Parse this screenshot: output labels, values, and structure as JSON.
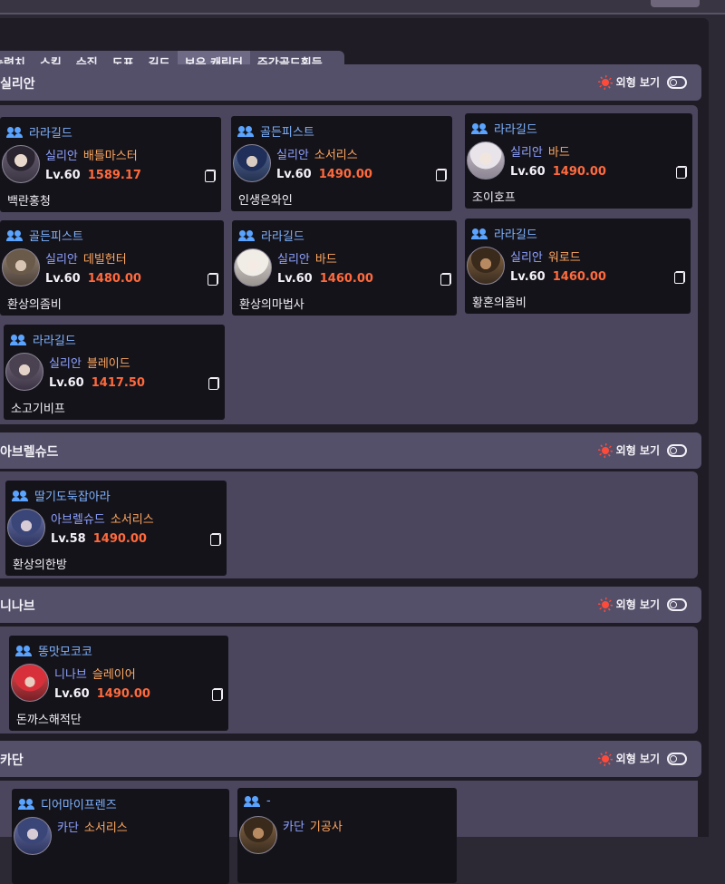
{
  "tabs": [
    "능력치",
    "스킬",
    "수집",
    "도표",
    "길드",
    "보유 캐릭터",
    "주간골드획득"
  ],
  "appearance_label": "외형 보기",
  "colors": {
    "guild": "#7fb3ff",
    "server": "#8ea2ff",
    "class": "#ffa860",
    "item_level": "#ff6a3d",
    "sun_icon": "#ff4a3a"
  },
  "regions": [
    {
      "name": "실리안",
      "characters": [
        {
          "guild": "라라길드",
          "server": "실리안",
          "class": "배틀마스터",
          "level": "Lv.60",
          "item_level": "1589.17",
          "name": "백란홍청"
        },
        {
          "guild": "골든피스트",
          "server": "실리안",
          "class": "소서리스",
          "level": "Lv.60",
          "item_level": "1490.00",
          "name": "인생은와인"
        },
        {
          "guild": "라라길드",
          "server": "실리안",
          "class": "바드",
          "level": "Lv.60",
          "item_level": "1490.00",
          "name": "조이호프"
        },
        {
          "guild": "골든피스트",
          "server": "실리안",
          "class": "데빌헌터",
          "level": "Lv.60",
          "item_level": "1480.00",
          "name": "환상의좀비"
        },
        {
          "guild": "라라길드",
          "server": "실리안",
          "class": "바드",
          "level": "Lv.60",
          "item_level": "1460.00",
          "name": "환상의마법사"
        },
        {
          "guild": "라라길드",
          "server": "실리안",
          "class": "워로드",
          "level": "Lv.60",
          "item_level": "1460.00",
          "name": "황혼의좀비"
        },
        {
          "guild": "라라길드",
          "server": "실리안",
          "class": "블레이드",
          "level": "Lv.60",
          "item_level": "1417.50",
          "name": "소고기비프"
        }
      ]
    },
    {
      "name": "아브렐슈드",
      "characters": [
        {
          "guild": "딸기도둑잡아라",
          "server": "아브렐슈드",
          "class": "소서리스",
          "level": "Lv.58",
          "item_level": "1490.00",
          "name": "환상의한방"
        }
      ]
    },
    {
      "name": "니나브",
      "characters": [
        {
          "guild": "똥맛모코코",
          "server": "니나브",
          "class": "슬레이어",
          "level": "Lv.60",
          "item_level": "1490.00",
          "name": "돈까스해적단"
        }
      ]
    },
    {
      "name": "카단",
      "characters": [
        {
          "guild": "디어마이프렌즈",
          "server": "카단",
          "class": "소서리스"
        },
        {
          "guild": "-",
          "server": "카단",
          "class": "기공사"
        }
      ]
    }
  ]
}
